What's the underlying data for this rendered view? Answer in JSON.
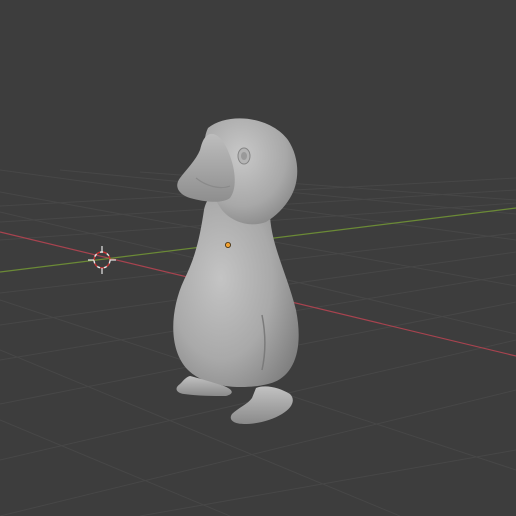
{
  "viewport": {
    "background_color": "#3d3d3d",
    "grid_line_color": "#4a4a4a",
    "x_axis_color": "#a8434f",
    "y_axis_color": "#6b8a36",
    "object_color": "#a6a6a6",
    "origin_color": "#f0a030"
  },
  "scene": {
    "object_name": "duck",
    "object_icon": "duck-sculpt-mesh",
    "cursor_icon": "3d-cursor-icon",
    "origin_icon": "object-origin-icon"
  }
}
